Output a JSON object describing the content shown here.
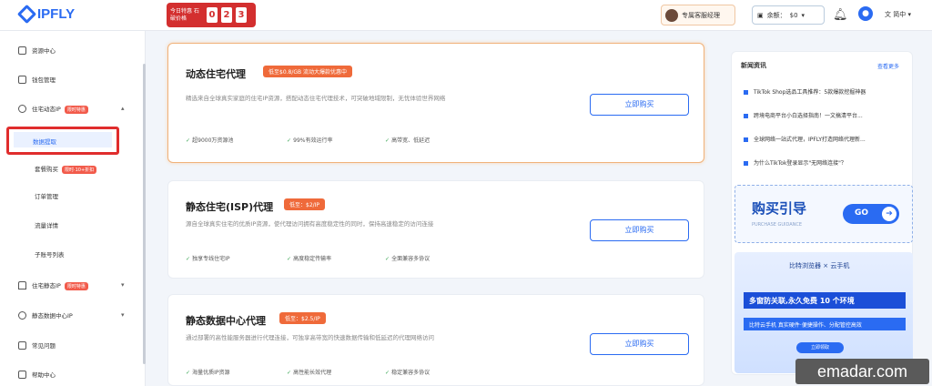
{
  "app": {
    "logo_text": "IPFLY"
  },
  "header": {
    "promo_text": "今日特惠 石破价格",
    "promo_digits": [
      "0",
      "2",
      "3"
    ],
    "advisor_label": "专属客服经理",
    "balance_label": "余额：",
    "balance_value": "$0",
    "lang_label": "简中"
  },
  "sidebar": {
    "items": [
      {
        "label": "资源中心"
      },
      {
        "label": "钱包管理"
      },
      {
        "label": "住宅动态IP",
        "tag": "限时特惠"
      },
      {
        "label": "数据提取"
      },
      {
        "label": "套餐购买",
        "tag": "限时·10+折扣"
      },
      {
        "label": "订单管理"
      },
      {
        "label": "流量详情"
      },
      {
        "label": "子账号列表"
      },
      {
        "label": "住宅静态IP",
        "tag": "限时特惠"
      },
      {
        "label": "静态数据中心IP"
      },
      {
        "label": "常见问题"
      },
      {
        "label": "帮助中心"
      }
    ]
  },
  "products": [
    {
      "title": "动态住宅代理",
      "badge": "低至$0.8/GB 流动大爆款优惠中",
      "desc": "精选来自全球真实家庭的住宅IP资源，搭配动态住宅代理技术，可突破地域限制，无忧体验世界网络",
      "features": [
        "超9000万资源池",
        "99%有效运行率",
        "高带宽、低延迟"
      ],
      "button": "立即购买"
    },
    {
      "title": "静态住宅(ISP)代理",
      "badge": "低至：$2/IP",
      "desc": "源自全球真实住宅的优质IP资源，使代理访问拥有高度稳定性的同时，保持高速稳定的访问连接",
      "features": [
        "独享专线住宅IP",
        "高度稳定传输率",
        "全面兼容多协议"
      ],
      "button": "立即购买"
    },
    {
      "title": "静态数据中心代理",
      "badge": "低至：$2.5/IP",
      "desc": "通过部署的高性能服务器进行代理连接，可独享高带宽的快速数据传输和低延迟的代理网络访问",
      "features": [
        "海量优质IP资源",
        "高性能长效代理",
        "稳定兼容多协议"
      ],
      "button": "立即购买"
    }
  ],
  "news": {
    "title": "新闻资讯",
    "more": "查看更多",
    "items": [
      "TikTok Shop选品工具推荐：5款爆款挖掘神器",
      "跨境电商平台小白选择指南！一文搞清平台...",
      "全球网络一站式代理，IPFLY打造网络代理新...",
      "为什么TikTok登录显示\"无网络连接\"？"
    ]
  },
  "guide": {
    "title": "购买引导",
    "subtitle": "PURCHASE GUIDANCE",
    "go": "GO"
  },
  "banner": {
    "brand": "比特浏览器 × 云手机",
    "headline": "多窗防关联,永久免费 10 个环境",
    "subline": "比特云手机 真实硬件·便捷操作、分配管控高效",
    "cta": "立即领取"
  },
  "watermark": "emadar.com"
}
